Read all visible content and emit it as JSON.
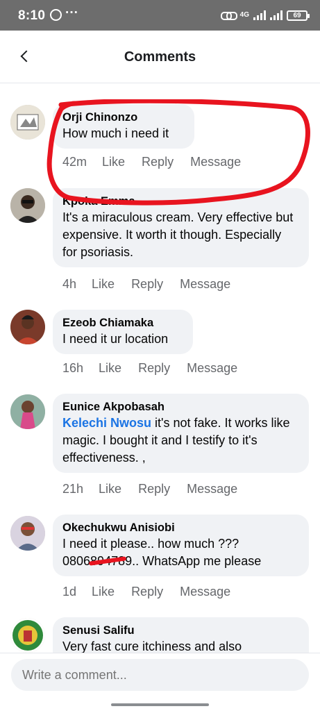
{
  "status_bar": {
    "time": "8:10",
    "dots": "···",
    "network": "4G",
    "battery": "69"
  },
  "header": {
    "title": "Comments"
  },
  "comments": [
    {
      "name": "Orji Chinonzo",
      "text": "How much i need it",
      "time": "42m",
      "like": "Like",
      "reply": "Reply",
      "message": "Message"
    },
    {
      "name": "Kpoka Emma",
      "text": "It's a miraculous cream. Very effective but expensive. It worth it though. Especially for psoriasis.",
      "time": "4h",
      "like": "Like",
      "reply": "Reply",
      "message": "Message"
    },
    {
      "name": "Ezeob Chiamaka",
      "text": "I need it ur location",
      "time": "16h",
      "like": "Like",
      "reply": "Reply",
      "message": "Message"
    },
    {
      "name": "Eunice Akpobasah",
      "mention": "Kelechi Nwosu",
      "text": "it's not fake. It works like magic. I bought it and I testify to it's effectiveness. ,",
      "time": "21h",
      "like": "Like",
      "reply": "Reply",
      "message": "Message"
    },
    {
      "name": "Okechukwu Anisiobi",
      "text_line1": "I need it please.. how much ???",
      "phone_visible_start": "0806",
      "phone_redacted": "89478",
      "phone_visible_end": "9",
      "text_line2_rest": ".. WhatsApp me please",
      "time": "1d",
      "like": "Like",
      "reply": "Reply",
      "message": "Message"
    },
    {
      "name": "Senusi Salifu",
      "text": "Very fast cure itchiness and also"
    }
  ],
  "composer": {
    "placeholder": "Write a comment..."
  },
  "colors": {
    "annotation": "#e8141f",
    "mention": "#1b74e4",
    "bubble": "#f0f2f5"
  }
}
